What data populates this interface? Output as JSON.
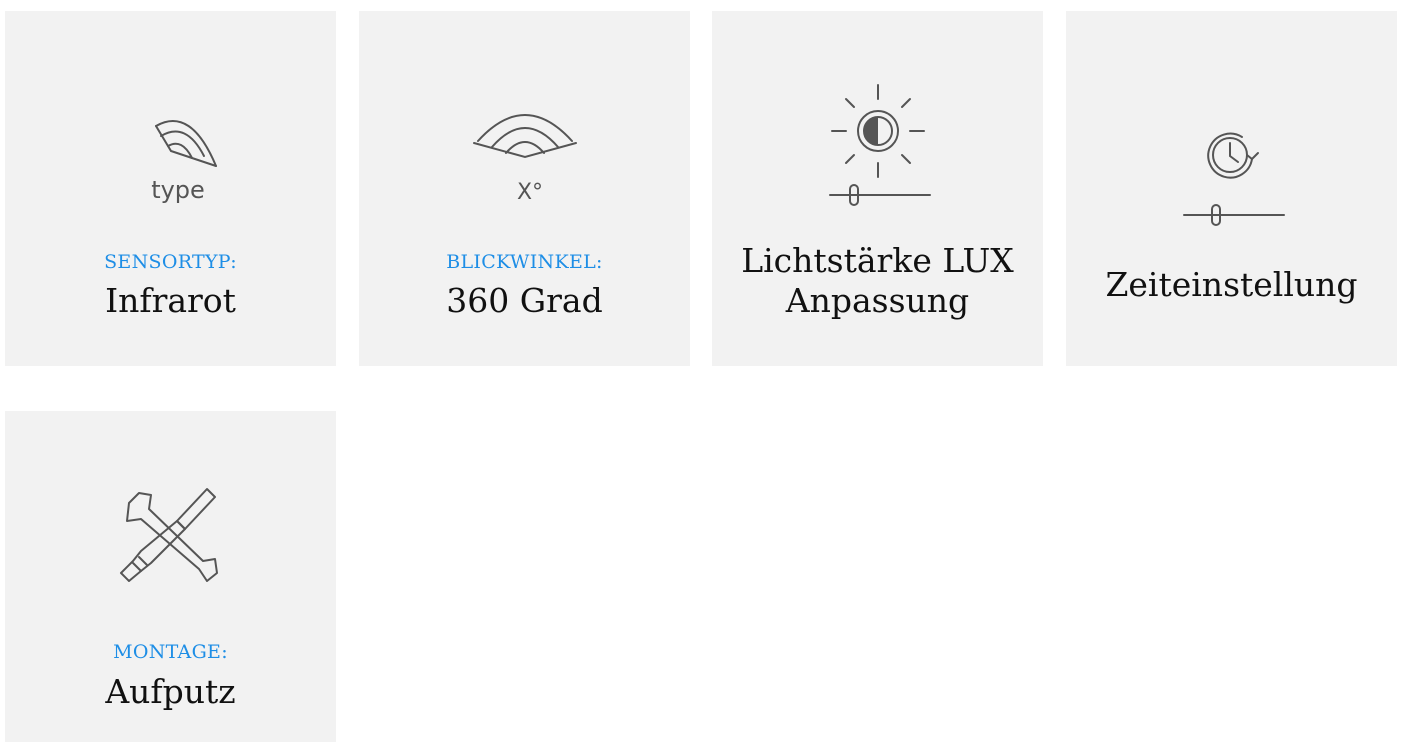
{
  "tiles": [
    {
      "label": "SENSORTYP:",
      "value": "Infrarot",
      "icon": "sensor-type-icon",
      "icon_text": "type"
    },
    {
      "label": "BLICKWINKEL:",
      "value": "360 Grad",
      "icon": "viewing-angle-icon",
      "icon_text": "X°"
    },
    {
      "value_line1": "Lichtstärke LUX",
      "value_line2": "Anpassung",
      "icon": "brightness-slider-icon"
    },
    {
      "value": "Zeiteinstellung",
      "icon": "timer-slider-icon"
    },
    {
      "label": "MONTAGE:",
      "value": "Aufputz",
      "icon": "tools-icon"
    }
  ],
  "colors": {
    "tile_bg": "#f2f2f2",
    "label": "#1e8ee6",
    "value": "#111111",
    "icon_stroke": "#555555"
  }
}
